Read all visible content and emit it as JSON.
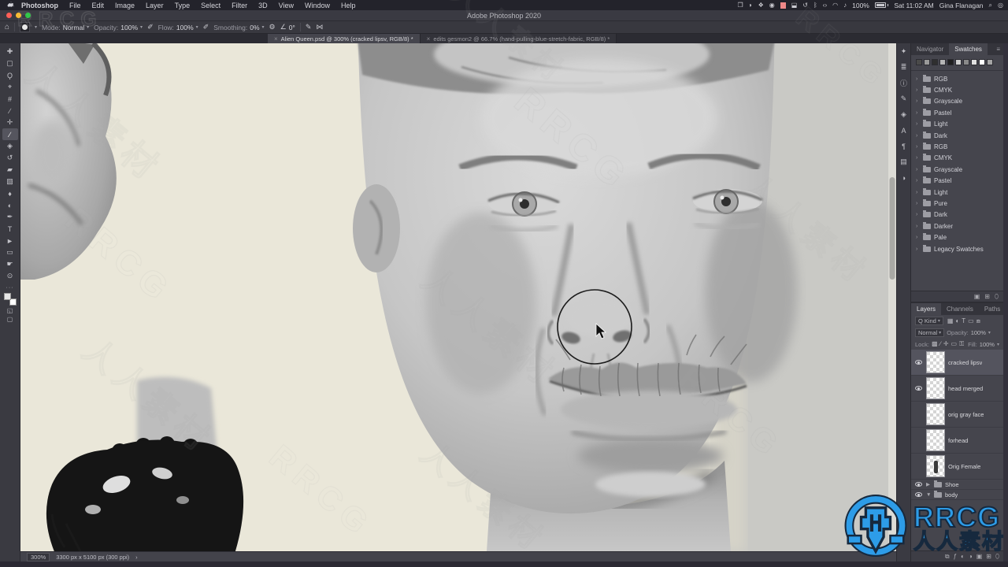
{
  "menubar": {
    "menus": [
      "Photoshop",
      "File",
      "Edit",
      "Image",
      "Layer",
      "Type",
      "Select",
      "Filter",
      "3D",
      "View",
      "Window",
      "Help"
    ],
    "status_icons": [
      {
        "name": "window-icon",
        "glyph": "❐"
      },
      {
        "name": "moon-icon",
        "glyph": "◗"
      },
      {
        "name": "dropbox-icon",
        "glyph": "❖"
      },
      {
        "name": "eye-icon",
        "glyph": "◉"
      },
      {
        "name": "color-swatch-icon",
        "glyph": ""
      },
      {
        "name": "airplay-display-icon",
        "glyph": "⬓"
      },
      {
        "name": "time-machine-icon",
        "glyph": "↺"
      },
      {
        "name": "bluetooth-icon",
        "glyph": "ᛒ"
      },
      {
        "name": "code-icon",
        "glyph": "‹›"
      },
      {
        "name": "wifi-icon",
        "glyph": "◠"
      },
      {
        "name": "volume-icon",
        "glyph": "♪"
      }
    ],
    "battery_percent": "100%",
    "clock": "Sat 11:02 AM",
    "user": "Gina Flanagan",
    "search_glyph": "⌕",
    "siri_glyph": "◎"
  },
  "titlebar": {
    "title": "Adobe Photoshop 2020"
  },
  "options": {
    "mode_label": "Mode:",
    "mode_value": "Normal",
    "opacity_label": "Opacity:",
    "opacity_value": "100%",
    "flow_label": "Flow:",
    "flow_value": "100%",
    "smoothing_label": "Smoothing:",
    "smoothing_value": "0%",
    "angle_value": "0°"
  },
  "tabs": [
    {
      "label": "Alien Queen.psd @ 300% (cracked lipsv, RGB/8) *",
      "active": true
    },
    {
      "label": "edits gesmon2 @ 66.7% (hand-pulling-blue-stretch-fabric, RGB/8) *",
      "active": false
    }
  ],
  "tools": [
    {
      "name": "move-tool",
      "glyph": "✚"
    },
    {
      "name": "marquee-tool",
      "glyph": "▢"
    },
    {
      "name": "lasso-tool",
      "glyph": "Ϙ"
    },
    {
      "name": "quick-selection-tool",
      "glyph": "⌖"
    },
    {
      "name": "crop-tool",
      "glyph": "#"
    },
    {
      "name": "eyedropper-tool",
      "glyph": "∕"
    },
    {
      "name": "healing-brush-tool",
      "glyph": "✛"
    },
    {
      "name": "brush-tool",
      "glyph": "∕",
      "active": true
    },
    {
      "name": "clone-stamp-tool",
      "glyph": "◈"
    },
    {
      "name": "history-brush-tool",
      "glyph": "↺"
    },
    {
      "name": "eraser-tool",
      "glyph": "▰"
    },
    {
      "name": "gradient-tool",
      "glyph": "▧"
    },
    {
      "name": "blur-tool",
      "glyph": "♦"
    },
    {
      "name": "dodge-tool",
      "glyph": "◐"
    },
    {
      "name": "pen-tool",
      "glyph": "✒"
    },
    {
      "name": "type-tool",
      "glyph": "T"
    },
    {
      "name": "path-selection-tool",
      "glyph": "►"
    },
    {
      "name": "shape-tool",
      "glyph": "▭"
    },
    {
      "name": "hand-tool",
      "glyph": "☛"
    },
    {
      "name": "zoom-tool",
      "glyph": "⊙"
    }
  ],
  "panel_strip": [
    {
      "name": "brushes-panel-icon",
      "glyph": "✦"
    },
    {
      "name": "brush-settings-panel-icon",
      "glyph": "≣"
    },
    {
      "name": "info-panel-icon",
      "glyph": "ⓘ"
    },
    {
      "name": "properties-panel-icon",
      "glyph": "✎"
    },
    {
      "name": "clone-source-panel-icon",
      "glyph": "◈"
    },
    {
      "name": "character-panel-icon",
      "glyph": "A"
    },
    {
      "name": "paragraph-panel-icon",
      "glyph": "¶"
    },
    {
      "name": "libraries-panel-icon",
      "glyph": "▤"
    },
    {
      "name": "adjustments-panel-icon",
      "glyph": "◑"
    }
  ],
  "swatches_panel": {
    "tabs": [
      "Navigator",
      "Swatches"
    ],
    "active_tab": "Swatches",
    "swatch_colors": [
      "#4a4a4a",
      "#9a9a9a",
      "#2f2f2f",
      "#b5b5b5",
      "#1f1f1f",
      "#cfcfcf",
      "#8a8a8a",
      "#e0e0e0",
      "#ffffff",
      "#a5a5a5"
    ],
    "folders": [
      "RGB",
      "CMYK",
      "Grayscale",
      "Pastel",
      "Light",
      "Dark",
      "RGB",
      "CMYK",
      "Grayscale",
      "Pastel",
      "Light",
      "Pure",
      "Dark",
      "Darker",
      "Pale",
      "Legacy Swatches"
    ],
    "bottom_icons": [
      {
        "name": "new-group-icon",
        "glyph": "▣"
      },
      {
        "name": "new-swatch-icon",
        "glyph": "⊞"
      },
      {
        "name": "delete-swatch-icon",
        "glyph": "⬯"
      }
    ]
  },
  "layers_panel": {
    "tabs": [
      "Layers",
      "Channels",
      "Paths"
    ],
    "active_tab": "Layers",
    "search_glyph": "Q",
    "filter_label": "Kind",
    "filter_icons": [
      {
        "name": "filter-pixel-icon",
        "glyph": "▦"
      },
      {
        "name": "filter-adjustment-icon",
        "glyph": "◐"
      },
      {
        "name": "filter-type-icon",
        "glyph": "T"
      },
      {
        "name": "filter-shape-icon",
        "glyph": "▭"
      },
      {
        "name": "filter-smart-icon",
        "glyph": "⧈"
      }
    ],
    "blend_mode": "Normal",
    "opacity_label": "Opacity:",
    "opacity_value": "100%",
    "lock_label": "Lock:",
    "lock_icons": [
      {
        "name": "lock-transparency-icon",
        "glyph": "▩"
      },
      {
        "name": "lock-pixels-icon",
        "glyph": "∕"
      },
      {
        "name": "lock-position-icon",
        "glyph": "✛"
      },
      {
        "name": "lock-artboard-icon",
        "glyph": "▭"
      },
      {
        "name": "lock-all-icon",
        "glyph": "⚿"
      }
    ],
    "fill_label": "Fill:",
    "fill_value": "100%",
    "layers": [
      {
        "name": "cracked lipsv",
        "kind": "layer",
        "eye": true,
        "selected": true
      },
      {
        "name": "head merged",
        "kind": "layer",
        "eye": true,
        "selected": false
      },
      {
        "name": "orig gray face",
        "kind": "layer",
        "eye": false,
        "selected": false
      },
      {
        "name": "forhead",
        "kind": "layer",
        "eye": false,
        "selected": false
      },
      {
        "name": "Orig Female",
        "kind": "layer",
        "eye": false,
        "selected": false,
        "thumb_figure": true
      },
      {
        "name": "Shoe",
        "kind": "group",
        "eye": true,
        "collapsed": true
      },
      {
        "name": "body",
        "kind": "group",
        "eye": true,
        "collapsed": false
      }
    ],
    "bottom_icons": [
      {
        "name": "link-layers-icon",
        "glyph": "⧉"
      },
      {
        "name": "layer-style-icon",
        "glyph": "ƒ"
      },
      {
        "name": "layer-mask-icon",
        "glyph": "◐"
      },
      {
        "name": "adjustment-layer-icon",
        "glyph": "◑"
      },
      {
        "name": "new-group-icon",
        "glyph": "▣"
      },
      {
        "name": "new-layer-icon",
        "glyph": "⊞"
      },
      {
        "name": "delete-layer-icon",
        "glyph": "⬯"
      }
    ]
  },
  "statusbar": {
    "zoom": "300%",
    "doc_info": "3300 px x 5100 px (300 ppi)",
    "chevron": "›"
  },
  "brand": {
    "name_en": "RRCG",
    "name_cn": "人人素材",
    "blue": "#2d9ce8"
  },
  "watermark": {
    "text_primary": "人人素材",
    "text_secondary": "RRCG"
  }
}
